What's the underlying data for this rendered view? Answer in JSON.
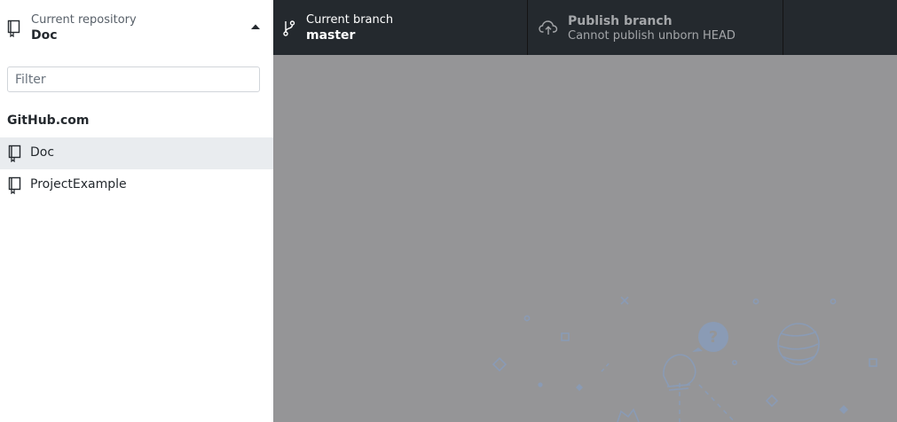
{
  "sidebar": {
    "repo_selector": {
      "label": "Current repository",
      "value": "Doc",
      "icon": "repo-icon",
      "caret": "caret-up-icon"
    },
    "filter": {
      "placeholder": "Filter",
      "value": ""
    },
    "group_title": "GitHub.com",
    "repos": [
      {
        "name": "Doc",
        "selected": true,
        "icon": "repo-icon"
      },
      {
        "name": "ProjectExample",
        "selected": false,
        "icon": "repo-icon"
      }
    ]
  },
  "toolbar": {
    "branch": {
      "label": "Current branch",
      "value": "master",
      "icon": "git-branch-icon"
    },
    "publish": {
      "label": "Publish branch",
      "value": "Cannot publish unborn HEAD",
      "icon": "cloud-upload-icon"
    }
  },
  "colors": {
    "toolbar_bg": "#24292e",
    "overlay_bg": "#959597",
    "selected_bg": "#e9ecef",
    "illustration": "#8a9bb5"
  }
}
